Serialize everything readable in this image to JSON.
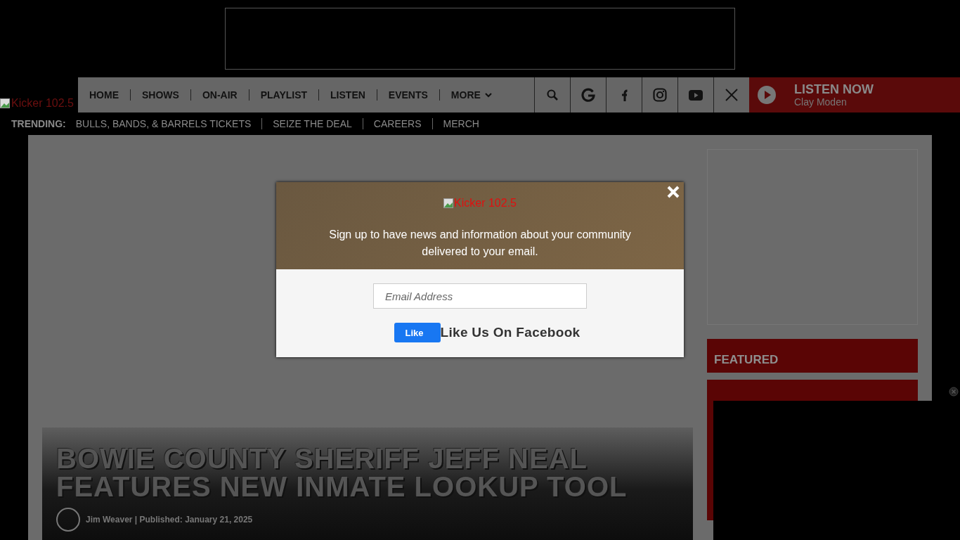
{
  "logo": {
    "text": "Kicker 102.5"
  },
  "nav": {
    "items": [
      {
        "label": "HOME",
        "kind": "link"
      },
      {
        "label": "SHOWS",
        "kind": "link"
      },
      {
        "label": "ON-AIR",
        "kind": "link"
      },
      {
        "label": "PLAYLIST",
        "kind": "link"
      },
      {
        "label": "LISTEN",
        "kind": "link"
      },
      {
        "label": "EVENTS",
        "kind": "link"
      },
      {
        "label": "MORE",
        "kind": "dropdown"
      }
    ]
  },
  "listen": {
    "label": "LISTEN NOW",
    "show": "Clay Moden"
  },
  "trending": {
    "label": "TRENDING:",
    "items": [
      "BULLS, BANDS, & BARRELS TICKETS",
      "SEIZE THE DEAL",
      "CAREERS",
      "MERCH"
    ]
  },
  "article": {
    "headline": "BOWIE COUNTY SHERIFF JEFF NEAL FEATURES NEW INMATE LOOKUP TOOL",
    "byline": "Jim Weaver | Published: January 21, 2025"
  },
  "sidebar": {
    "featured_title": "FEATURED"
  },
  "modal": {
    "logo": "Kicker 102.5",
    "message": "Sign up to have news and information about your community delivered to your email.",
    "email_placeholder": "Email Address",
    "like_button": "Like",
    "facebook_label": "Like Us On Facebook"
  }
}
